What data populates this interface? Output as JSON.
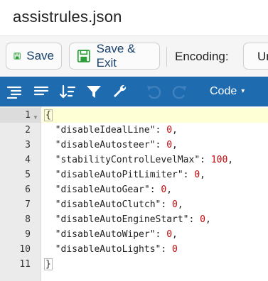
{
  "window": {
    "title": "assistrules.json"
  },
  "actions": {
    "save_label": "Save",
    "save_exit_label": "Save & Exit",
    "encoding_label": "Encoding:",
    "encoding_value": "Ur"
  },
  "toolbar": {
    "mode_label": "Code",
    "icons": [
      "format-icon",
      "compact-icon",
      "sort-icon",
      "filter-icon",
      "repair-icon",
      "undo-icon",
      "redo-icon"
    ]
  },
  "editor": {
    "line_numbers": [
      "1",
      "2",
      "3",
      "4",
      "5",
      "6",
      "7",
      "8",
      "9",
      "10",
      "11"
    ],
    "open_brace": "{",
    "close_brace": "}",
    "entries": [
      {
        "key": "\"disableIdealLine\"",
        "value": "0",
        "sep": ","
      },
      {
        "key": "\"disableAutosteer\"",
        "value": "0",
        "sep": ","
      },
      {
        "key": "\"stabilityControlLevelMax\"",
        "value": "100",
        "sep": ","
      },
      {
        "key": "\"disableAutoPitLimiter\"",
        "value": "0",
        "sep": ","
      },
      {
        "key": "\"disableAutoGear\"",
        "value": "0",
        "sep": ","
      },
      {
        "key": "\"disableAutoClutch\"",
        "value": "0",
        "sep": ","
      },
      {
        "key": "\"disableAutoEngineStart\"",
        "value": "0",
        "sep": ","
      },
      {
        "key": "\"disableAutoWiper\"",
        "value": "0",
        "sep": ","
      },
      {
        "key": "\"disableAutoLights\"",
        "value": "0",
        "sep": ""
      }
    ]
  },
  "colors": {
    "toolbar_bg": "#1e6bb0",
    "value_red": "#c5060b",
    "active_line": "#ffffd6",
    "save_icon_green": "#2e9e3a"
  }
}
